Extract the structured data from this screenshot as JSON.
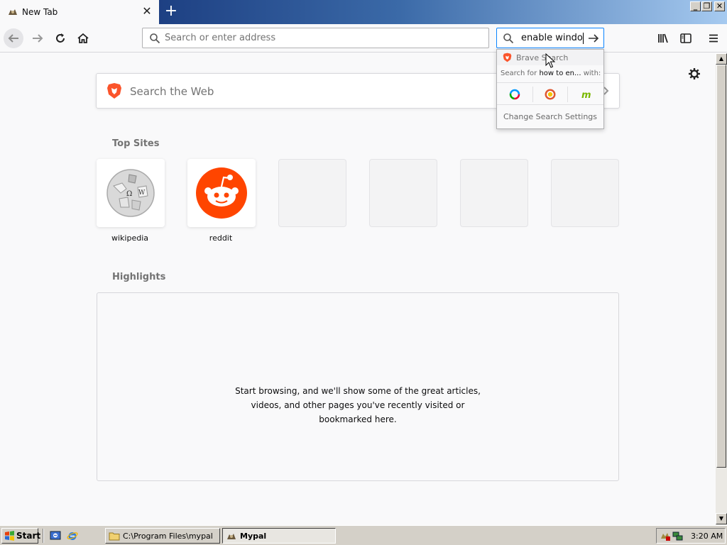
{
  "window": {
    "tab_title": "New Tab",
    "new_tab_symbol": "+",
    "close_tab_symbol": "✕",
    "minimize_symbol": "_",
    "restore_symbol": "❐",
    "close_symbol": "✕"
  },
  "toolbar": {
    "url_placeholder": "Search or enter address",
    "search_value": "enable window"
  },
  "search_dropdown": {
    "engine_header": "Brave Search",
    "search_for_prefix": "Search for ",
    "search_for_query": "how to en...",
    "search_for_suffix": " with:",
    "engine_icons": [
      "qwant-icon",
      "duckduckgo-icon",
      "mojeek-icon"
    ],
    "change_settings": "Change Search Settings"
  },
  "newtab": {
    "search_placeholder": "Search the Web",
    "top_sites_title": "Top Sites",
    "top_sites": [
      {
        "label": "wikipedia",
        "icon": "wikipedia-icon"
      },
      {
        "label": "reddit",
        "icon": "reddit-icon"
      },
      {
        "label": "",
        "icon": ""
      },
      {
        "label": "",
        "icon": ""
      },
      {
        "label": "",
        "icon": ""
      },
      {
        "label": "",
        "icon": ""
      }
    ],
    "highlights_title": "Highlights",
    "highlights_message": "Start browsing, and we'll show some of the great articles, videos, and other pages you've recently visited or bookmarked here."
  },
  "taskbar": {
    "start_label": "Start",
    "tasks": [
      {
        "label": "C:\\Program Files\\mypal",
        "active": false
      },
      {
        "label": "Mypal",
        "active": true
      }
    ],
    "clock": "3:20 AM"
  },
  "colors": {
    "accent": "#0a84ff",
    "reddit": "#ff4500",
    "brave": "#fb542b"
  }
}
